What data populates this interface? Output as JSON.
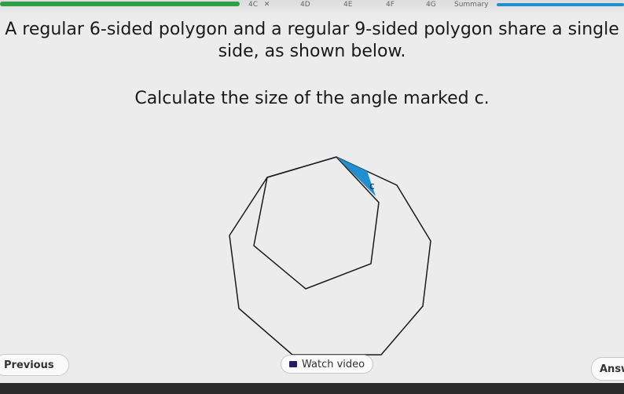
{
  "tabs": [
    {
      "label": "4C",
      "status": "wrong"
    },
    {
      "label": "4D",
      "status": "none"
    },
    {
      "label": "4E",
      "status": "none"
    },
    {
      "label": "4F",
      "status": "none"
    },
    {
      "label": "4G",
      "status": "none"
    },
    {
      "label": "Summary",
      "status": "none"
    }
  ],
  "tab_wrong_mark": "✕",
  "question": {
    "line1": "A regular 6-sided polygon and a regular 9-sided polygon share a single",
    "line2": "side, as shown below.",
    "line3": "Calculate the size of the angle marked c."
  },
  "figure": {
    "angle_label": "c",
    "highlight_color": "#1f8fd0"
  },
  "buttons": {
    "previous": "Previous",
    "watch_video": "Watch video",
    "answer": "Answ"
  },
  "colors": {
    "progress_green": "#2f9e44",
    "progress_blue": "#1f8fd0"
  }
}
